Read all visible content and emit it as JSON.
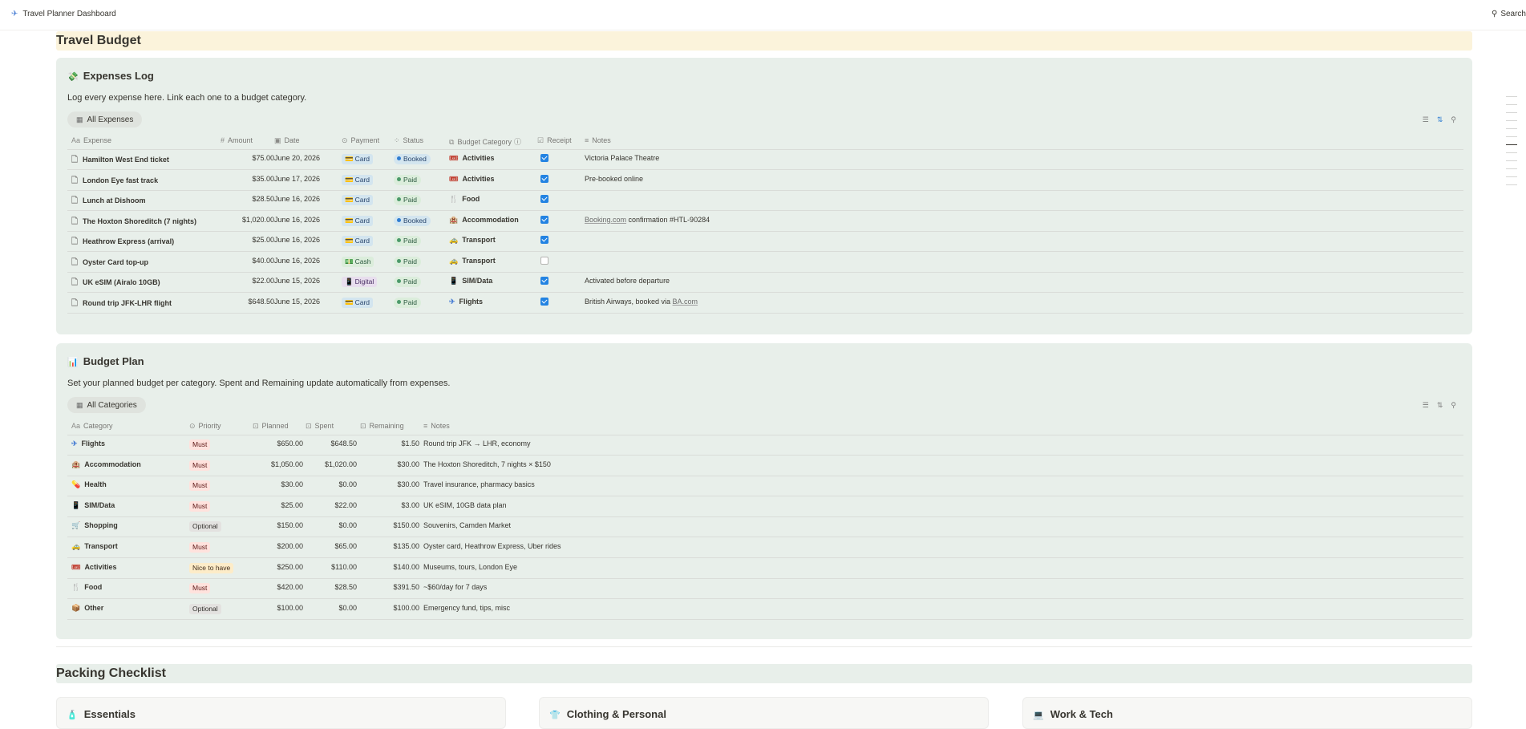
{
  "app": {
    "title": "Travel Planner Dashboard",
    "search_label": "Search"
  },
  "sections": {
    "budget": "Travel Budget",
    "packing": "Packing Checklist"
  },
  "expenses": {
    "title": "Expenses Log",
    "description": "Log every expense here. Link each one to a budget category.",
    "view_tab": "All Expenses",
    "columns": [
      "Expense",
      "Amount",
      "Date",
      "Payment",
      "Status",
      "Budget Category",
      "Receipt",
      "Notes"
    ],
    "rows": [
      {
        "name": "Hamilton West End ticket",
        "amount": "$75.00",
        "date": "June 20, 2026",
        "payment": "Card",
        "status": "Booked",
        "category": "Activities",
        "receipt": true,
        "notes": "Victoria Palace Theatre"
      },
      {
        "name": "London Eye fast track",
        "amount": "$35.00",
        "date": "June 17, 2026",
        "payment": "Card",
        "status": "Paid",
        "category": "Activities",
        "receipt": true,
        "notes": "Pre-booked online"
      },
      {
        "name": "Lunch at Dishoom",
        "amount": "$28.50",
        "date": "June 16, 2026",
        "payment": "Card",
        "status": "Paid",
        "category": "Food",
        "receipt": true,
        "notes": ""
      },
      {
        "name": "The Hoxton Shoreditch (7 nights)",
        "amount": "$1,020.00",
        "date": "June 16, 2026",
        "payment": "Card",
        "status": "Booked",
        "category": "Accommodation",
        "receipt": true,
        "notes_link": "Booking.com",
        "notes": " confirmation #HTL-90284"
      },
      {
        "name": "Heathrow Express (arrival)",
        "amount": "$25.00",
        "date": "June 16, 2026",
        "payment": "Card",
        "status": "Paid",
        "category": "Transport",
        "receipt": true,
        "notes": ""
      },
      {
        "name": "Oyster Card top-up",
        "amount": "$40.00",
        "date": "June 16, 2026",
        "payment": "Cash",
        "status": "Paid",
        "category": "Transport",
        "receipt": false,
        "notes": ""
      },
      {
        "name": "UK eSIM (Airalo 10GB)",
        "amount": "$22.00",
        "date": "June 15, 2026",
        "payment": "Digital",
        "status": "Paid",
        "category": "SIM/Data",
        "receipt": true,
        "notes": "Activated before departure"
      },
      {
        "name": "Round trip JFK-LHR flight",
        "amount": "$648.50",
        "date": "June 15, 2026",
        "payment": "Card",
        "status": "Paid",
        "category": "Flights",
        "receipt": true,
        "notes": "British Airways, booked via ",
        "notes_link_after": "BA.com"
      }
    ]
  },
  "budget_plan": {
    "title": "Budget Plan",
    "description": "Set your planned budget per category. Spent and Remaining update automatically from expenses.",
    "view_tab": "All Categories",
    "columns": [
      "Category",
      "Priority",
      "Planned",
      "Spent",
      "Remaining",
      "Notes"
    ],
    "rows": [
      {
        "category": "Flights",
        "priority": "Must",
        "planned": "$650.00",
        "spent": "$648.50",
        "remaining": "$1.50",
        "notes": "Round trip JFK → LHR, economy"
      },
      {
        "category": "Accommodation",
        "priority": "Must",
        "planned": "$1,050.00",
        "spent": "$1,020.00",
        "remaining": "$30.00",
        "notes": "The Hoxton Shoreditch, 7 nights × $150"
      },
      {
        "category": "Health",
        "priority": "Must",
        "planned": "$30.00",
        "spent": "$0.00",
        "remaining": "$30.00",
        "notes": "Travel insurance, pharmacy basics"
      },
      {
        "category": "SIM/Data",
        "priority": "Must",
        "planned": "$25.00",
        "spent": "$22.00",
        "remaining": "$3.00",
        "notes": "UK eSIM, 10GB data plan"
      },
      {
        "category": "Shopping",
        "priority": "Optional",
        "planned": "$150.00",
        "spent": "$0.00",
        "remaining": "$150.00",
        "notes": "Souvenirs, Camden Market"
      },
      {
        "category": "Transport",
        "priority": "Must",
        "planned": "$200.00",
        "spent": "$65.00",
        "remaining": "$135.00",
        "notes": "Oyster card, Heathrow Express, Uber rides"
      },
      {
        "category": "Activities",
        "priority": "Nice to have",
        "planned": "$250.00",
        "spent": "$110.00",
        "remaining": "$140.00",
        "notes": "Museums, tours, London Eye"
      },
      {
        "category": "Food",
        "priority": "Must",
        "planned": "$420.00",
        "spent": "$28.50",
        "remaining": "$391.50",
        "notes": "~$60/day for 7 days"
      },
      {
        "category": "Other",
        "priority": "Optional",
        "planned": "$100.00",
        "spent": "$0.00",
        "remaining": "$100.00",
        "notes": "Emergency fund, tips, misc"
      }
    ]
  },
  "packing_cards": [
    "Essentials",
    "Clothing & Personal",
    "Work & Tech"
  ],
  "category_icons": {
    "Flights": "airplane-icon",
    "Accommodation": "hotel-icon",
    "Health": "pill-icon",
    "SIM/Data": "phone-icon",
    "Shopping": "cart-icon",
    "Transport": "car-icon",
    "Activities": "ticket-icon",
    "Food": "utensils-icon",
    "Other": "package-icon"
  }
}
